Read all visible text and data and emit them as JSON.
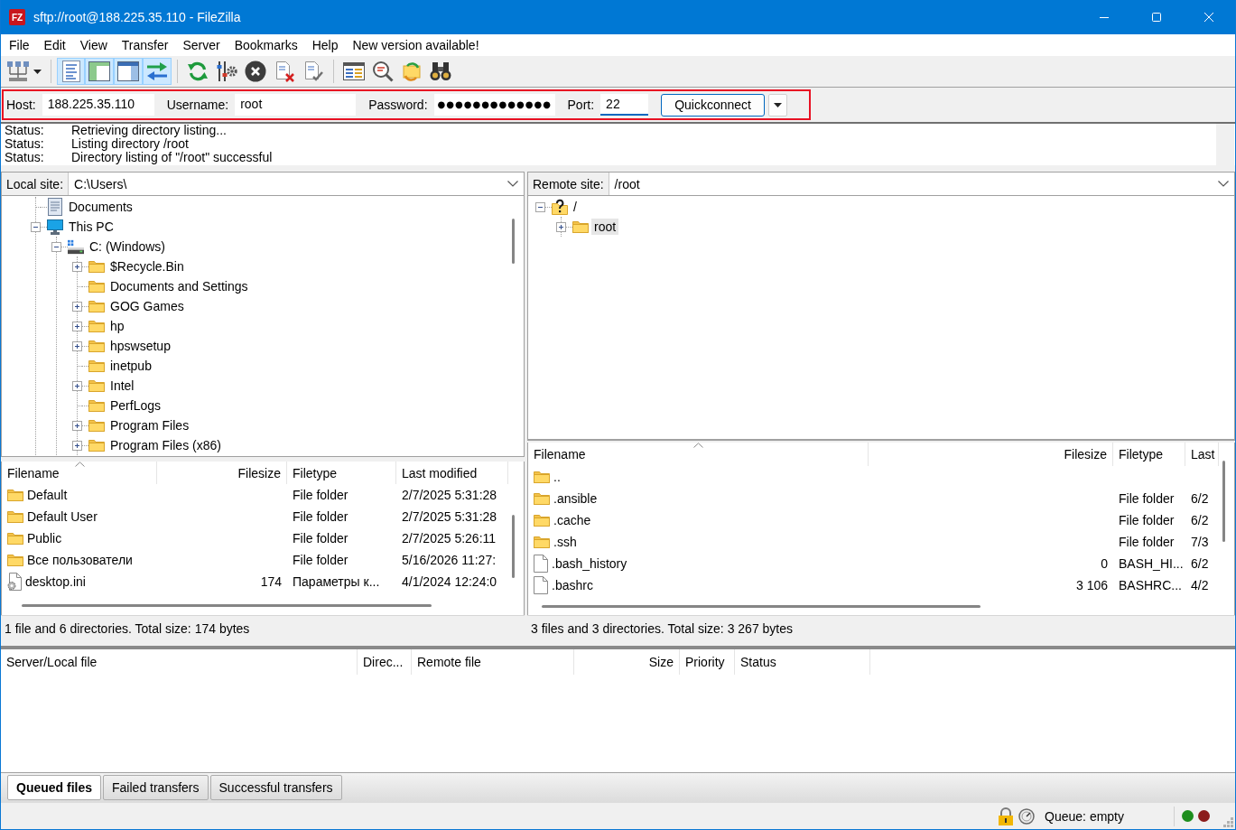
{
  "window": {
    "logo": "FZ",
    "title": "sftp://root@188.225.35.110 - FileZilla"
  },
  "menu": [
    "File",
    "Edit",
    "View",
    "Transfer",
    "Server",
    "Bookmarks",
    "Help",
    "New version available!"
  ],
  "toolbar": [
    {
      "buttons": [
        {
          "kind": "site-manager",
          "pressed": false
        }
      ]
    },
    {
      "buttons": [
        {
          "kind": "message-log",
          "pressed": true
        },
        {
          "kind": "local-tree",
          "pressed": true
        },
        {
          "kind": "remote-tree",
          "pressed": true
        },
        {
          "kind": "transfer-queue",
          "pressed": true
        }
      ]
    },
    {
      "buttons": [
        {
          "kind": "refresh",
          "pressed": false
        },
        {
          "kind": "process-queue",
          "pressed": false
        },
        {
          "kind": "cancel",
          "pressed": false
        },
        {
          "kind": "disconnect",
          "pressed": false
        },
        {
          "kind": "reconnect",
          "pressed": false
        }
      ]
    },
    {
      "buttons": [
        {
          "kind": "filters",
          "pressed": false
        },
        {
          "kind": "compare",
          "pressed": false
        },
        {
          "kind": "sync-browsing",
          "pressed": false
        },
        {
          "kind": "search",
          "pressed": false
        }
      ]
    }
  ],
  "quickconnect": {
    "highlighted": true,
    "fields": [
      {
        "kind": "host",
        "label": "Host:",
        "value": "188.225.35.110",
        "focused": false
      },
      {
        "kind": "username",
        "label": "Username:",
        "value": "root",
        "focused": false
      },
      {
        "kind": "password",
        "label": "Password:",
        "value": "●●●●●●●●●●●●●",
        "focused": false
      },
      {
        "kind": "port",
        "label": "Port:",
        "value": "22",
        "focused": true
      }
    ],
    "button": "Quickconnect"
  },
  "message_log": [
    {
      "label": "Status:",
      "message": "Retrieving directory listing..."
    },
    {
      "label": "Status:",
      "message": "Listing directory /root"
    },
    {
      "label": "Status:",
      "message": "Directory listing of \"/root\" successful"
    }
  ],
  "local": {
    "site_label": "Local site:",
    "path": "C:\\Users\\",
    "tree": [
      {
        "kind": "documents",
        "label": "Documents",
        "selected": false
      },
      {
        "kind": "computer",
        "label": "This PC",
        "expanded": true,
        "selected": false,
        "children": [
          {
            "kind": "drive",
            "label": "C: (Windows)",
            "expanded": true,
            "selected": false,
            "children": [
              {
                "kind": "folder",
                "label": "$Recycle.Bin",
                "expanded": false,
                "selected": false
              },
              {
                "kind": "folder",
                "label": "Documents and Settings",
                "selected": false
              },
              {
                "kind": "folder",
                "label": "GOG Games",
                "expanded": false,
                "selected": false
              },
              {
                "kind": "folder",
                "label": "hp",
                "expanded": false,
                "selected": false
              },
              {
                "kind": "folder",
                "label": "hpswsetup",
                "expanded": false,
                "selected": false
              },
              {
                "kind": "folder",
                "label": "inetpub",
                "selected": false
              },
              {
                "kind": "folder",
                "label": "Intel",
                "expanded": false,
                "selected": false
              },
              {
                "kind": "folder",
                "label": "PerfLogs",
                "selected": false
              },
              {
                "kind": "folder",
                "label": "Program Files",
                "expanded": false,
                "selected": false
              },
              {
                "kind": "folder",
                "label": "Program Files (x86)",
                "expanded": false,
                "selected": false
              }
            ]
          }
        ]
      }
    ],
    "list": {
      "columns": [
        {
          "label": "Filename",
          "kind": "text",
          "sorted": true
        },
        {
          "label": "Filesize",
          "kind": "number",
          "sorted": false
        },
        {
          "label": "Filetype",
          "kind": "text",
          "sorted": false
        },
        {
          "label": "Last modified",
          "kind": "text",
          "sorted": false
        }
      ],
      "rows": [
        {
          "kind": "folder",
          "name": "Default",
          "type": "File folder",
          "modified": "2/7/2025 5:31:28"
        },
        {
          "kind": "folder",
          "name": "Default User",
          "type": "File folder",
          "modified": "2/7/2025 5:31:28"
        },
        {
          "kind": "folder",
          "name": "Public",
          "type": "File folder",
          "modified": "2/7/2025 5:26:11"
        },
        {
          "kind": "folder",
          "name": "Все пользователи",
          "type": "File folder",
          "modified": "5/16/2026 11:27:"
        },
        {
          "kind": "config",
          "name": "desktop.ini",
          "size": "174",
          "type": "Параметры к...",
          "modified": "4/1/2024 12:24:0"
        }
      ]
    },
    "summary": "1 file and 6 directories. Total size: 174 bytes"
  },
  "remote": {
    "site_label": "Remote site:",
    "path": "/root",
    "tree": [
      {
        "kind": "unknown",
        "label": "/",
        "expanded": true,
        "selected": false,
        "children": [
          {
            "kind": "folder",
            "label": "root",
            "expanded": false,
            "selected": true
          }
        ]
      }
    ],
    "list": {
      "columns": [
        {
          "label": "Filename",
          "kind": "text",
          "sorted": true
        },
        {
          "label": "Filesize",
          "kind": "number",
          "sorted": false
        },
        {
          "label": "Filetype",
          "kind": "text",
          "sorted": false
        },
        {
          "label": "Last",
          "kind": "text",
          "sorted": false
        }
      ],
      "rows": [
        {
          "kind": "folder",
          "name": ".."
        },
        {
          "kind": "folder",
          "name": ".ansible",
          "type": "File folder",
          "modified": "6/2"
        },
        {
          "kind": "folder",
          "name": ".cache",
          "type": "File folder",
          "modified": "6/2"
        },
        {
          "kind": "folder",
          "name": ".ssh",
          "type": "File folder",
          "modified": "7/3"
        },
        {
          "kind": "file",
          "name": ".bash_history",
          "size": "0",
          "type": "BASH_HI...",
          "modified": "6/2"
        },
        {
          "kind": "file",
          "name": ".bashrc",
          "size": "3 106",
          "type": "BASHRC...",
          "modified": "4/2"
        }
      ]
    },
    "summary": "3 files and 3 directories. Total size: 3 267 bytes"
  },
  "queue": {
    "columns": [
      {
        "label": "Server/Local file",
        "kind": "text"
      },
      {
        "label": "Direc...",
        "kind": "text"
      },
      {
        "label": "Remote file",
        "kind": "text"
      },
      {
        "label": "Size",
        "kind": "number"
      },
      {
        "label": "Priority",
        "kind": "text"
      },
      {
        "label": "Status",
        "kind": "text"
      }
    ]
  },
  "queue_tabs": [
    {
      "label": "Queued files",
      "selected": true
    },
    {
      "label": "Failed transfers",
      "selected": false
    },
    {
      "label": "Successful transfers",
      "selected": false
    }
  ],
  "status_bar": {
    "queue": "Queue: empty",
    "lights": [
      {
        "color": "#1e8e1e"
      },
      {
        "color": "#8b1c1c"
      }
    ]
  }
}
